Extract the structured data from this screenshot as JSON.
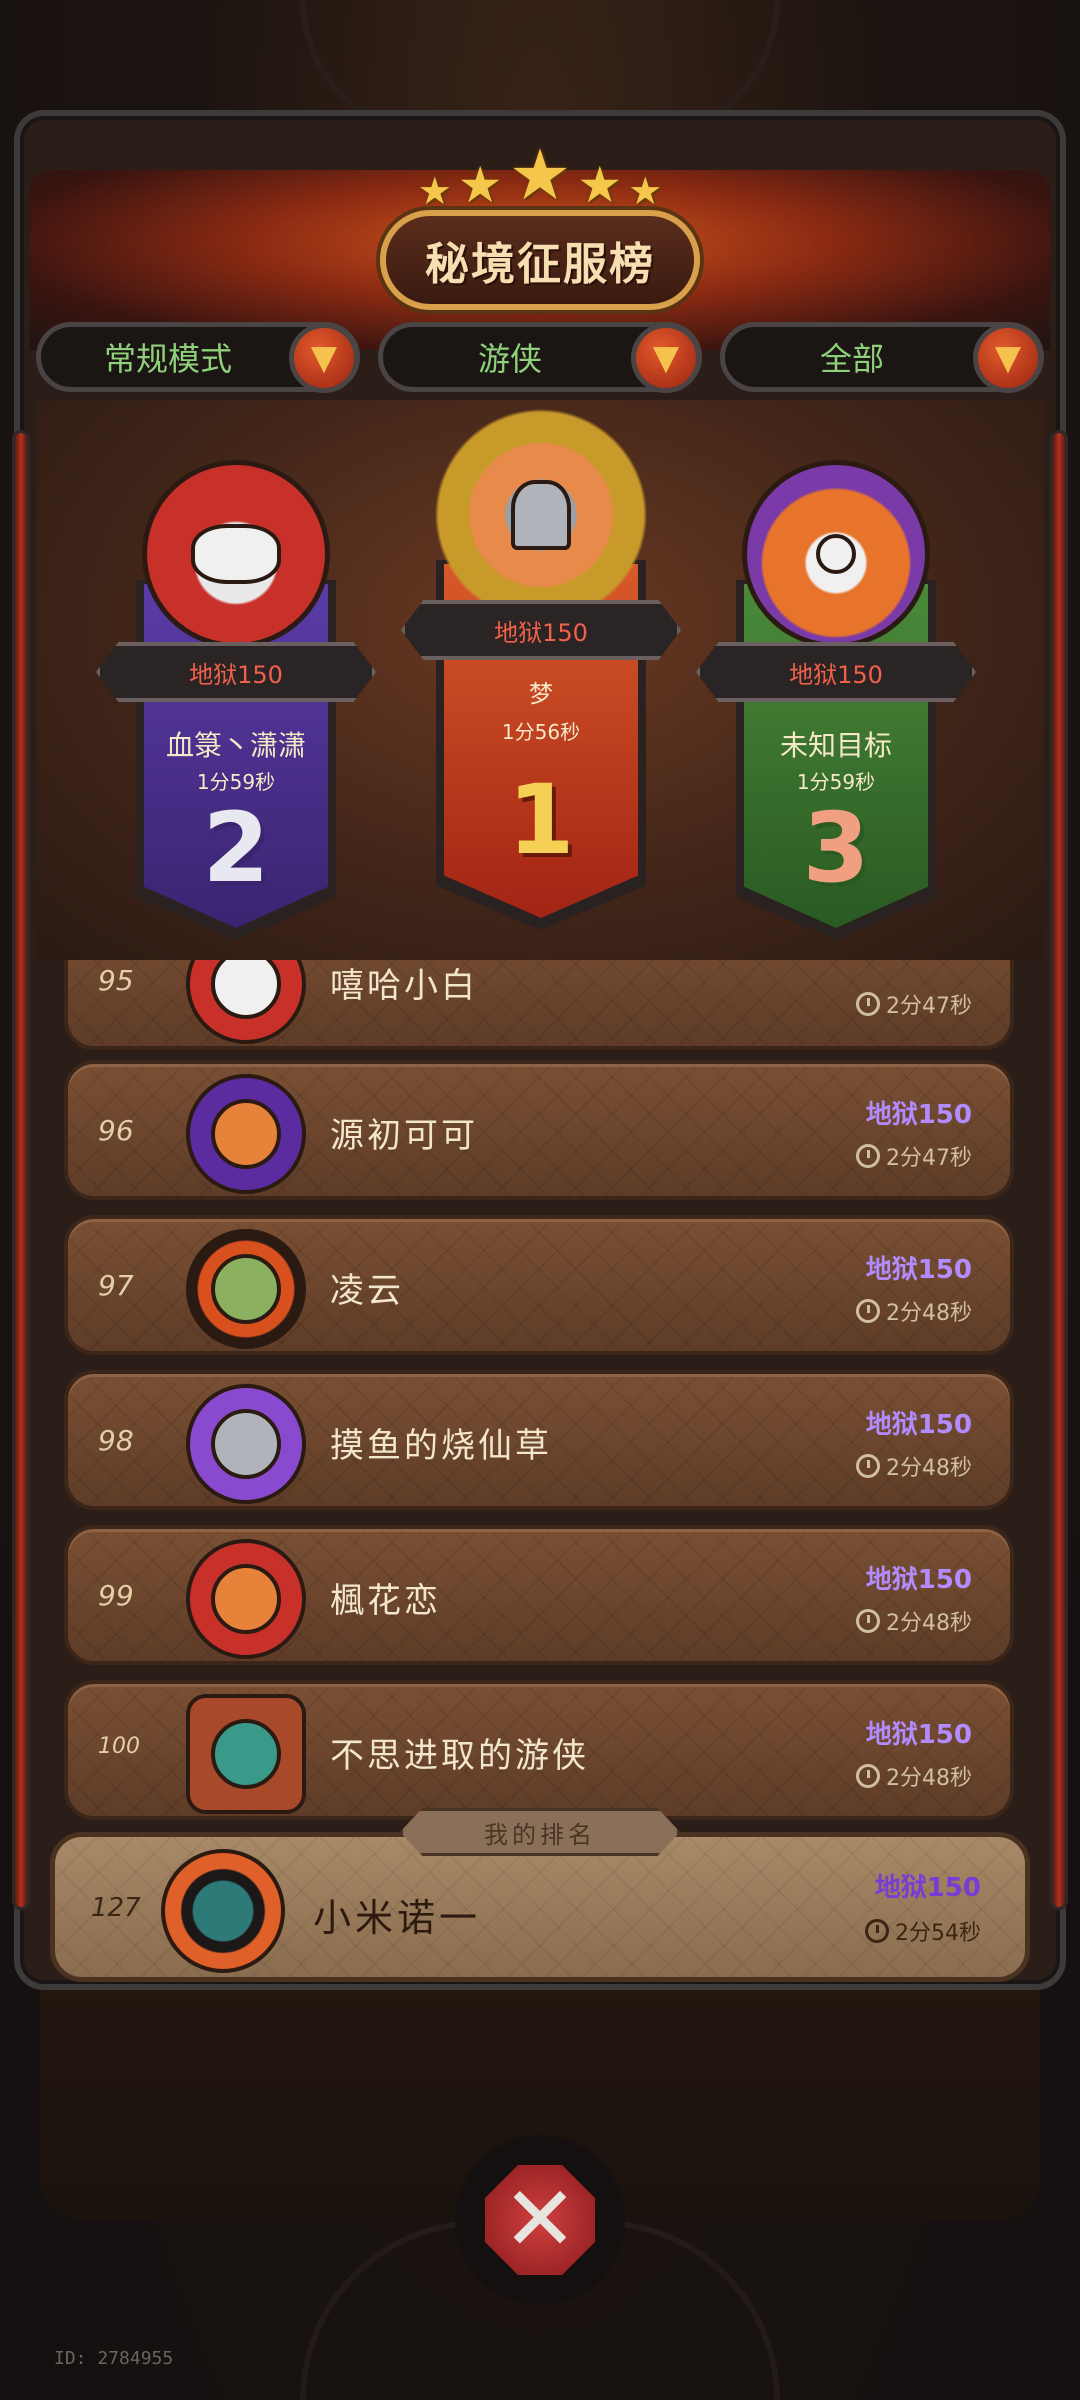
{
  "title": "秘境征服榜",
  "filters": [
    {
      "label": "常规模式"
    },
    {
      "label": "游侠"
    },
    {
      "label": "全部"
    }
  ],
  "podium": {
    "first": {
      "tier": "地狱150",
      "name": "梦",
      "time": "1分56秒",
      "rank": "1"
    },
    "second": {
      "tier": "地狱150",
      "name": "血箓丶潇潇",
      "time": "1分59秒",
      "rank": "2"
    },
    "third": {
      "tier": "地狱150",
      "name": "未知目标",
      "time": "1分59秒",
      "rank": "3"
    }
  },
  "list": [
    {
      "rank": "95",
      "name": "嘻哈小白",
      "tier": "",
      "time": "2分47秒"
    },
    {
      "rank": "96",
      "name": "源初可可",
      "tier": "地狱150",
      "time": "2分47秒"
    },
    {
      "rank": "97",
      "name": "凌云",
      "tier": "地狱150",
      "time": "2分48秒"
    },
    {
      "rank": "98",
      "name": "摸鱼的烧仙草",
      "tier": "地狱150",
      "time": "2分48秒"
    },
    {
      "rank": "99",
      "name": "楓花恋",
      "tier": "地狱150",
      "time": "2分48秒"
    },
    {
      "rank": "100",
      "name": "不思进取的游侠",
      "tier": "地狱150",
      "time": "2分48秒"
    }
  ],
  "my_ranking": {
    "label": "我的排名",
    "rank": "127",
    "name": "小米诺一",
    "tier": "地狱150",
    "time": "2分54秒"
  },
  "user_id": "ID: 2784955",
  "colors": {
    "tier_red": "#f0604a",
    "tier_purple": "#b28cff",
    "filter_green": "#8fd07a",
    "gold": "#f4c64a"
  },
  "icons": {
    "dropdown": "chevron-down-icon",
    "clock": "clock-icon",
    "close": "close-icon",
    "star": "star-icon"
  }
}
